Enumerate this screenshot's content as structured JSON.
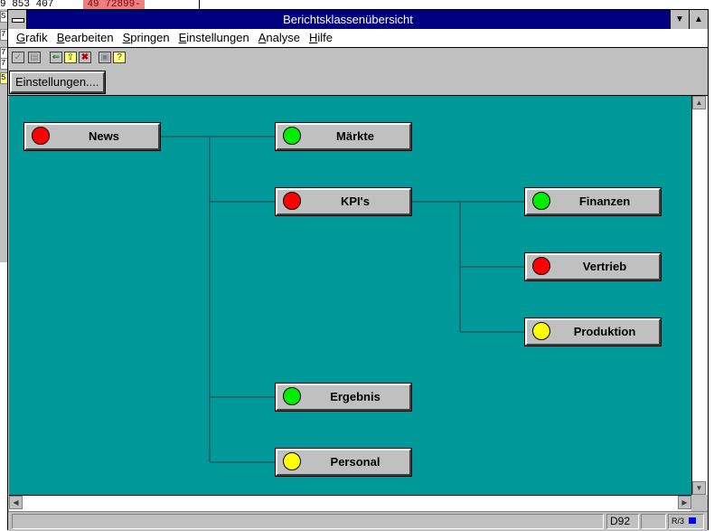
{
  "background_window": {
    "number_row": "9 853 407",
    "red_value": "49 72899-",
    "edge_labels": [
      "S",
      "7",
      "7",
      "7",
      "5"
    ]
  },
  "window": {
    "title": "Berichtsklassenübersicht",
    "minimize_glyph": "▼",
    "maximize_glyph": "▲"
  },
  "menu": {
    "items": [
      {
        "label": "Grafik",
        "accel": "G"
      },
      {
        "label": "Bearbeiten",
        "accel": "B"
      },
      {
        "label": "Springen",
        "accel": "S"
      },
      {
        "label": "Einstellungen",
        "accel": "E"
      },
      {
        "label": "Analyse",
        "accel": "A"
      },
      {
        "label": "Hilfe",
        "accel": "H"
      }
    ]
  },
  "toolbar": {
    "icons": [
      "check-icon",
      "save-icon",
      "back-arrow-icon",
      "up-arrow-icon",
      "cancel-icon",
      "find-icon",
      "help-icon"
    ]
  },
  "buttons": {
    "settings_label": "Einstellungen...."
  },
  "tree": {
    "lamp_colors": {
      "red": "#ff0000",
      "green": "#00ee00",
      "yellow": "#ffff00"
    },
    "nodes": [
      {
        "id": "news",
        "label": "News",
        "status": "red"
      },
      {
        "id": "maerkte",
        "label": "Märkte",
        "status": "green"
      },
      {
        "id": "kpis",
        "label": "KPI's",
        "status": "red"
      },
      {
        "id": "ergebnis",
        "label": "Ergebnis",
        "status": "green"
      },
      {
        "id": "personal",
        "label": "Personal",
        "status": "yellow"
      },
      {
        "id": "finanzen",
        "label": "Finanzen",
        "status": "green"
      },
      {
        "id": "vertrieb",
        "label": "Vertrieb",
        "status": "red"
      },
      {
        "id": "produktion",
        "label": "Produktion",
        "status": "yellow"
      }
    ]
  },
  "statusbar": {
    "system": "D92",
    "r3_label": "R/3"
  },
  "colors": {
    "title_bar": "#000080",
    "canvas": "#009999"
  }
}
